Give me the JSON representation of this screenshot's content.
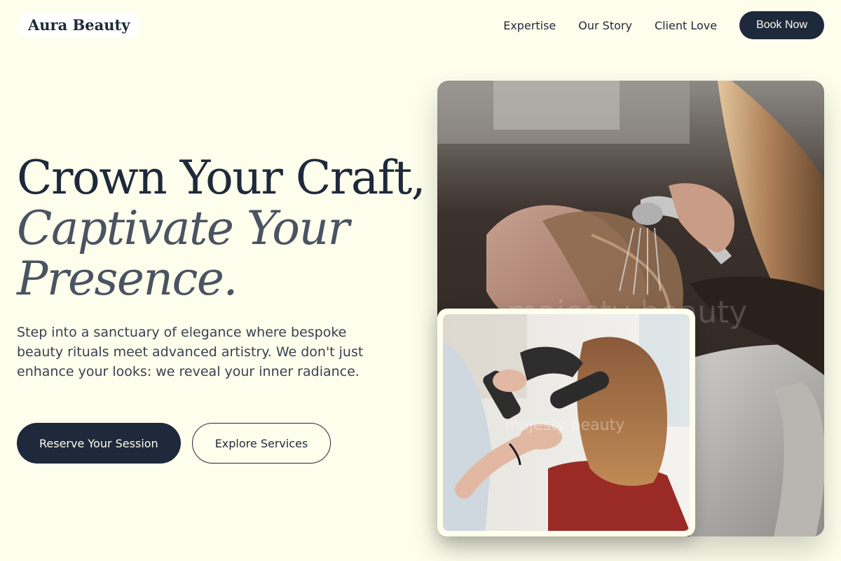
{
  "brand": {
    "name": "Aura Beauty"
  },
  "nav": {
    "links": [
      "Expertise",
      "Our Story",
      "Client Love"
    ],
    "cta_label": "Book Now"
  },
  "hero": {
    "headline_line1": "Crown Your Craft,",
    "headline_line2": "Captivate Your Presence.",
    "description": "Step into a sanctuary of elegance where bespoke beauty rituals meet advanced artistry. We don't just enhance your looks: we reveal your inner radiance.",
    "primary_cta": "Reserve Your Session",
    "secondary_cta": "Explore Services"
  },
  "images": {
    "main_watermark": "majesty beauty",
    "inset_watermark": "majesty beauty"
  },
  "colors": {
    "background": "#fefeec",
    "navy": "#1e293b",
    "muted_italic": "#4a5362"
  }
}
